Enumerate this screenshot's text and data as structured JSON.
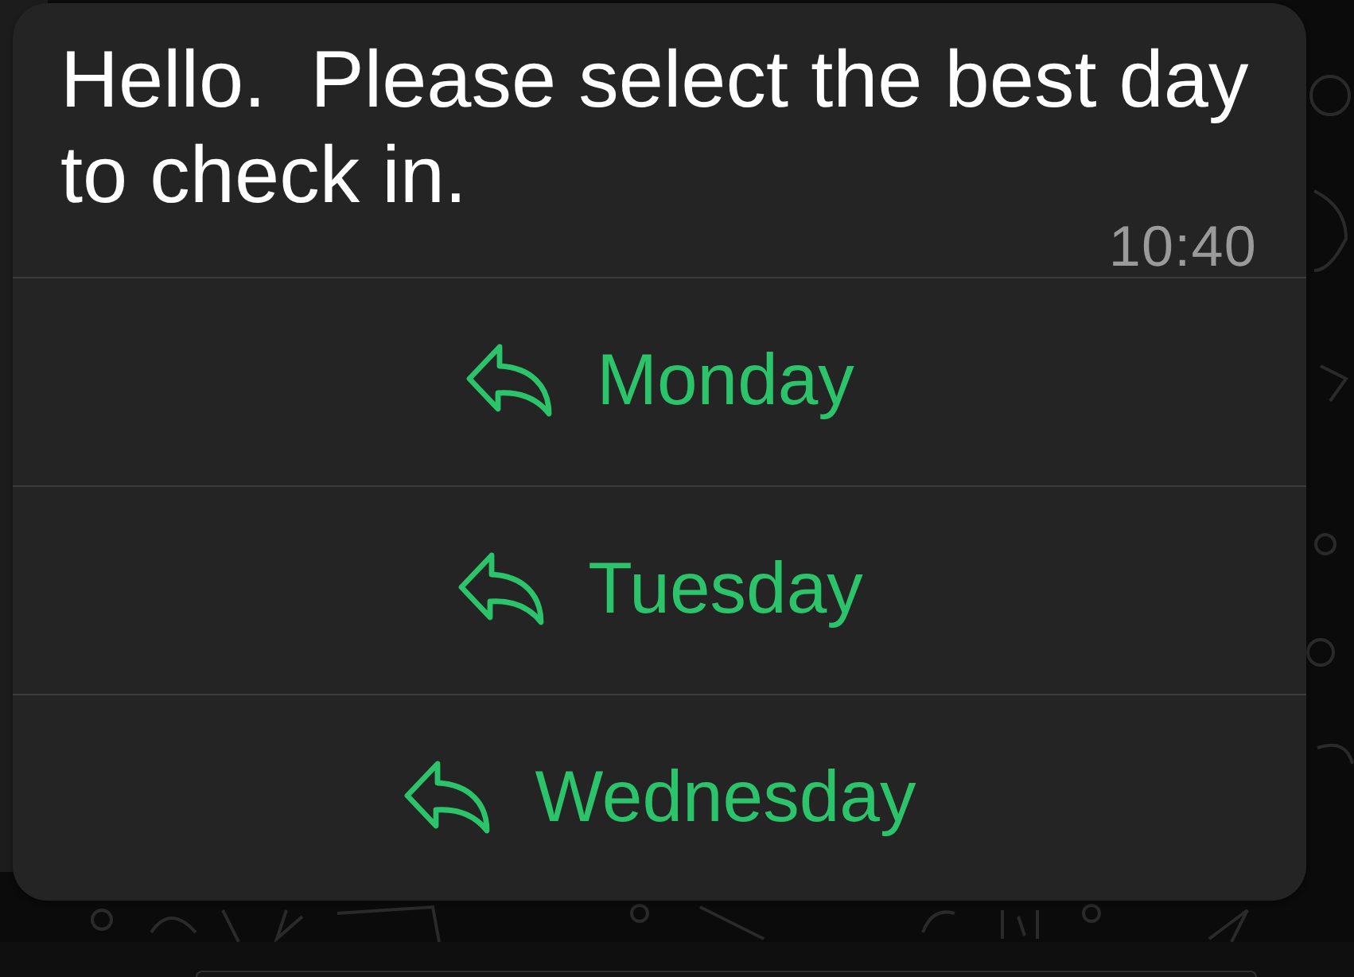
{
  "message": {
    "text": "Hello.  Please select the best day to check in.",
    "time": "10:40"
  },
  "quick_replies": [
    {
      "label": "Monday"
    },
    {
      "label": "Tuesday"
    },
    {
      "label": "Wednesday"
    }
  ]
}
